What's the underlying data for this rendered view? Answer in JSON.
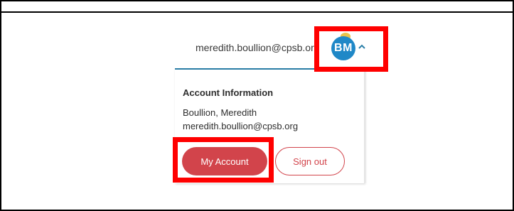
{
  "header": {
    "email": "meredith.boullion@cpsb.org",
    "avatar_initials": "BM",
    "chevron_icon": "chevron-up-icon"
  },
  "account_menu": {
    "title": "Account Information",
    "name": "Boullion, Meredith",
    "email": "meredith.boullion@cpsb.org",
    "my_account_label": "My Account",
    "sign_out_label": "Sign out"
  },
  "colors": {
    "accent_red": "#d2444b",
    "avatar_blue": "#1f88c7",
    "underline_blue": "#2b7fa8",
    "highlight_red": "#ff0000"
  }
}
